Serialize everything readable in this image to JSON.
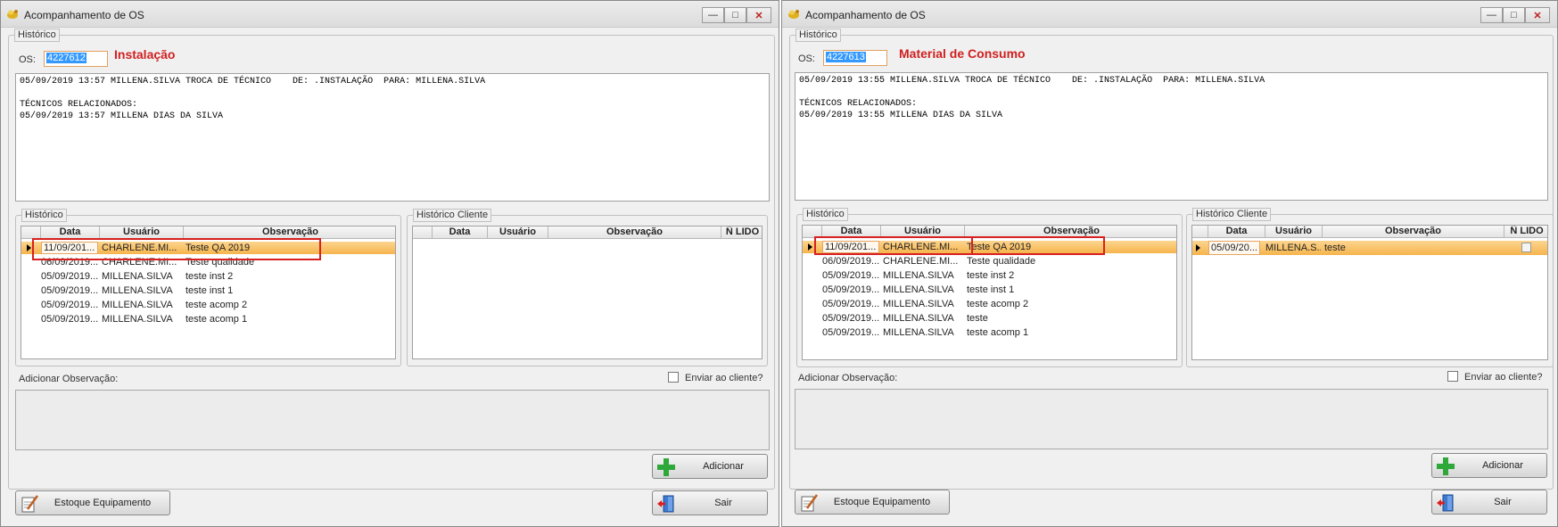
{
  "window_left": {
    "title": "Acompanhamento de OS",
    "historico_legend": "Histórico",
    "os_label": "OS:",
    "os_value": "4227612",
    "type_title": "Instalação",
    "log_text": "05/09/2019 13:57 MILLENA.SILVA TROCA DE TÉCNICO    DE: .INSTALAÇÃO  PARA: MILLENA.SILVA\n\nTÉCNICOS RELACIONADOS:\n05/09/2019 13:57 MILLENA DIAS DA SILVA",
    "hist_group_legend": "Histórico",
    "hist_columns": [
      "Data",
      "Usuário",
      "Observação"
    ],
    "hist_rows": [
      {
        "data": "11/09/201...",
        "usuario": "CHARLENE.MI...",
        "obs": "Teste QA 2019"
      },
      {
        "data": "06/09/2019...",
        "usuario": "CHARLENE.MI...",
        "obs": "Teste qualidade"
      },
      {
        "data": "05/09/2019...",
        "usuario": "MILLENA.SILVA",
        "obs": "teste inst 2"
      },
      {
        "data": "05/09/2019...",
        "usuario": "MILLENA.SILVA",
        "obs": "teste inst 1"
      },
      {
        "data": "05/09/2019...",
        "usuario": "MILLENA.SILVA",
        "obs": "teste acomp 2"
      },
      {
        "data": "05/09/2019...",
        "usuario": "MILLENA.SILVA",
        "obs": "teste acomp 1"
      }
    ],
    "client_group_legend": "Histórico Cliente",
    "client_columns": [
      "Data",
      "Usuário",
      "Observação",
      "Ñ LIDO"
    ],
    "client_rows": [],
    "add_obs_label": "Adicionar Observação:",
    "send_client_label": "Enviar ao cliente?",
    "adicionar_label": "Adicionar",
    "estoque_label": "Estoque Equipamento",
    "sair_label": "Sair"
  },
  "window_right": {
    "title": "Acompanhamento de OS",
    "historico_legend": "Histórico",
    "os_label": "OS:",
    "os_value": "4227613",
    "type_title": "Material de Consumo",
    "log_text": "05/09/2019 13:55 MILLENA.SILVA TROCA DE TÉCNICO    DE: .INSTALAÇÃO  PARA: MILLENA.SILVA\n\nTÉCNICOS RELACIONADOS:\n05/09/2019 13:55 MILLENA DIAS DA SILVA",
    "hist_group_legend": "Histórico",
    "hist_columns": [
      "Data",
      "Usuário",
      "Observação"
    ],
    "hist_rows": [
      {
        "data": "11/09/201...",
        "usuario": "CHARLENE.MI...",
        "obs": "Teste QA 2019"
      },
      {
        "data": "06/09/2019...",
        "usuario": "CHARLENE.MI...",
        "obs": "Teste qualidade"
      },
      {
        "data": "05/09/2019...",
        "usuario": "MILLENA.SILVA",
        "obs": "teste inst 2"
      },
      {
        "data": "05/09/2019...",
        "usuario": "MILLENA.SILVA",
        "obs": "teste inst 1"
      },
      {
        "data": "05/09/2019...",
        "usuario": "MILLENA.SILVA",
        "obs": "teste acomp 2"
      },
      {
        "data": "05/09/2019...",
        "usuario": "MILLENA.SILVA",
        "obs": "teste"
      },
      {
        "data": "05/09/2019...",
        "usuario": "MILLENA.SILVA",
        "obs": "teste acomp 1"
      }
    ],
    "client_group_legend": "Histórico Cliente",
    "client_columns": [
      "Data",
      "Usuário",
      "Observação",
      "Ñ LIDO"
    ],
    "client_rows": [
      {
        "data": "05/09/20...",
        "usuario": "MILLENA.S...",
        "obs": "teste"
      }
    ],
    "add_obs_label": "Adicionar Observação:",
    "send_client_label": "Enviar ao cliente?",
    "adicionar_label": "Adicionar",
    "estoque_label": "Estoque Equipamento",
    "sair_label": "Sair"
  },
  "colors": {
    "selected_row": "#f6b44c",
    "highlight_box": "#d82020",
    "type_title": "#d02020"
  },
  "icons": [
    "app-icon",
    "minimize-icon",
    "maximize-icon",
    "close-icon",
    "add-plus-icon",
    "edit-notepad-icon",
    "exit-door-icon"
  ]
}
